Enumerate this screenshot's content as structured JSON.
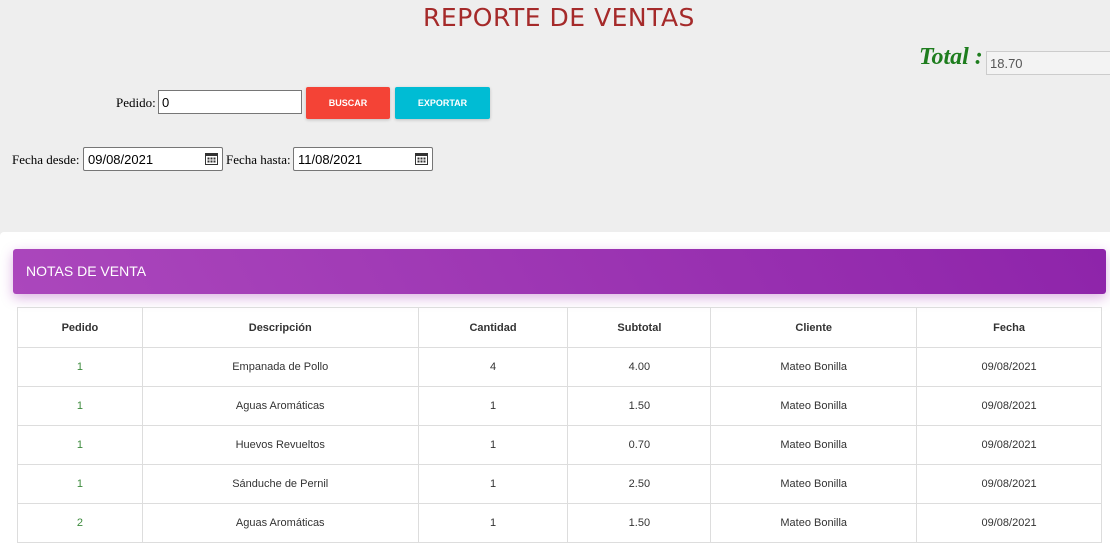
{
  "page": {
    "title": "REPORTE DE VENTAS",
    "total_label": "Total :",
    "total_value": "18.70"
  },
  "filters": {
    "pedido_label": "Pedido:",
    "pedido_value": "0",
    "buscar_label": "BUSCAR",
    "exportar_label": "EXPORTAR",
    "fecha_desde_label": "Fecha desde:",
    "fecha_desde_value": "09/08/2021",
    "fecha_hasta_label": "Fecha hasta:",
    "fecha_hasta_value": "11/08/2021"
  },
  "card": {
    "title": "NOTAS DE VENTA"
  },
  "table": {
    "headers": [
      "Pedido",
      "Descripción",
      "Cantidad",
      "Subtotal",
      "Cliente",
      "Fecha"
    ],
    "rows": [
      [
        "1",
        "Empanada de Pollo",
        "4",
        "4.00",
        "Mateo Bonilla",
        "09/08/2021"
      ],
      [
        "1",
        "Aguas Aromáticas",
        "1",
        "1.50",
        "Mateo Bonilla",
        "09/08/2021"
      ],
      [
        "1",
        "Huevos Revueltos",
        "1",
        "0.70",
        "Mateo Bonilla",
        "09/08/2021"
      ],
      [
        "1",
        "Sánduche de Pernil",
        "1",
        "2.50",
        "Mateo Bonilla",
        "09/08/2021"
      ],
      [
        "2",
        "Aguas Aromáticas",
        "1",
        "1.50",
        "Mateo Bonilla",
        "09/08/2021"
      ]
    ]
  },
  "icons": {
    "date_picker": "calendar-icon"
  },
  "colors": {
    "title": "#a52a2a",
    "total": "#1e7d1e",
    "buscar": "#f44336",
    "exportar": "#00bcd4",
    "header_start": "#ab47bc",
    "header_end": "#8e24aa"
  }
}
